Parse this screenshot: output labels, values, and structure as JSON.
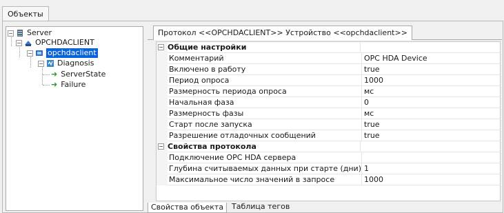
{
  "window_tab": "Объекты",
  "tree": {
    "server": "Server",
    "opc_client": "OPCHDACLIENT",
    "device": "opchdaclient",
    "diagnosis": "Diagnosis",
    "server_state": "ServerState",
    "failure": "Failure"
  },
  "panel_tab": "Протокол <<OPCHDACLIENT>> Устройство <<opchdaclient>>",
  "grid": {
    "cat_general": "Общие настройки",
    "cat_protocol": "Свойства протокола",
    "rows_general": [
      {
        "name": "Комментарий",
        "value": "OPC HDA Device"
      },
      {
        "name": "Включено в работу",
        "value": "true"
      },
      {
        "name": "Период опроса",
        "value": "1000"
      },
      {
        "name": "Размерность периода опроса",
        "value": "мс"
      },
      {
        "name": "Начальная фаза",
        "value": "0"
      },
      {
        "name": "Размерность фазы",
        "value": "мс"
      },
      {
        "name": "Старт после запуска",
        "value": "true"
      },
      {
        "name": "Разрешение отладочных сообщений",
        "value": "true"
      }
    ],
    "rows_protocol": [
      {
        "name": "Подключение OPC HDA сервера",
        "value": ""
      },
      {
        "name": "Глубина считываемых данных при старте (дни)",
        "value": "1"
      },
      {
        "name": "Максимальное число значений в запросе",
        "value": "1000"
      }
    ]
  },
  "bottom_tabs": {
    "properties": "Свойства объекта",
    "tags": "Таблица тегов"
  }
}
